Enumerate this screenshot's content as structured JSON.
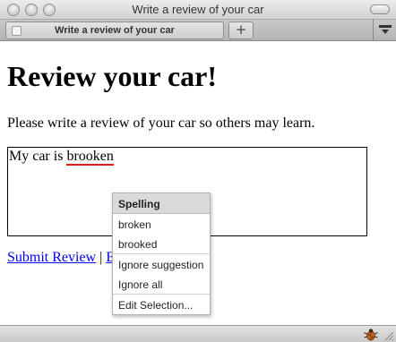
{
  "window": {
    "title": "Write a review of your car"
  },
  "tabs": [
    {
      "label": "Write a review of your car"
    }
  ],
  "new_tab_label": "+",
  "page": {
    "heading": "Review your car!",
    "intro": "Please write a review of your car so others may learn.",
    "review_value": {
      "before": "My car is ",
      "misspelled": "brooken"
    },
    "links": [
      {
        "label": "Submit Review"
      },
      {
        "separator": " | "
      },
      {
        "label": "E"
      }
    ]
  },
  "context_menu": {
    "header": "Spelling",
    "suggestions": [
      "broken",
      "brooked"
    ],
    "actions": [
      "Ignore suggestion",
      "Ignore all"
    ],
    "edit": "Edit Selection..."
  },
  "colors": {
    "link": "#0000ee",
    "spell_underline": "#d81e1e",
    "menu_header_bg": "#dadada"
  },
  "icons": [
    "tab-favicon-icon",
    "tab-menu-icon",
    "debugger-bug-icon",
    "resize-grip-icon"
  ]
}
